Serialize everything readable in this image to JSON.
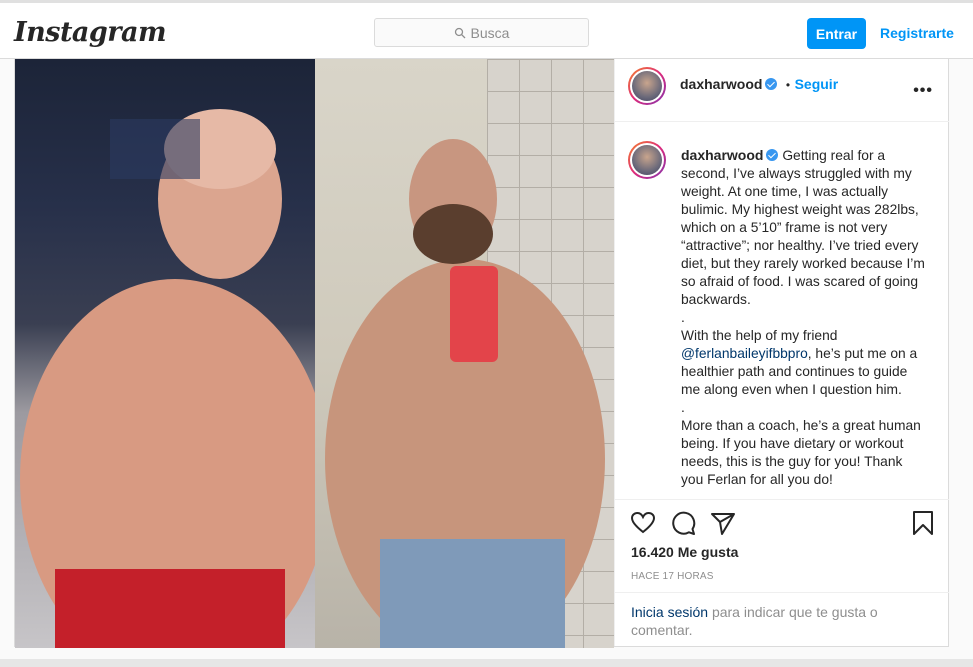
{
  "header": {
    "logo_text": "Instagram",
    "search_placeholder": "Busca",
    "login_label": "Entrar",
    "register_label": "Registrarte"
  },
  "post": {
    "username": "daxharwood",
    "follow_label": "Seguir",
    "follow_separator": "•",
    "more_label": "•••",
    "caption_lines": [
      "Getting real for a second, I’ve always struggled with my weight. At one time, I was actually bulimic. My highest weight was 282lbs, which on a 5’10” frame is not very “attractive”; nor healthy. I’ve tried every diet, but they rarely worked because I’m so afraid of food. I was scared of going backwards.",
      ".",
      "With the help of my friend",
      "@ferlanbaileyifbbpro",
      ", he’s put me on a healthier path and continues to guide me along even when I question him.",
      ".",
      "More than a coach, he’s a great human being. If you have dietary or workout needs, this is the guy for you!",
      "Thank you Ferlan for all you do!"
    ],
    "likes_count": "16.420",
    "likes_label": "Me gusta",
    "timestamp": "HACE 17 HORAS",
    "login_prompt_link": "Inicia sesión",
    "login_prompt_text": "para indicar que te gusta o comentar."
  },
  "icons": {
    "like": "heart-icon",
    "comment": "comment-icon",
    "share": "send-icon",
    "save": "bookmark-icon",
    "search": "search-icon"
  },
  "colors": {
    "accent": "#0095f6",
    "link": "#00376b",
    "verified": "#3897f0"
  }
}
